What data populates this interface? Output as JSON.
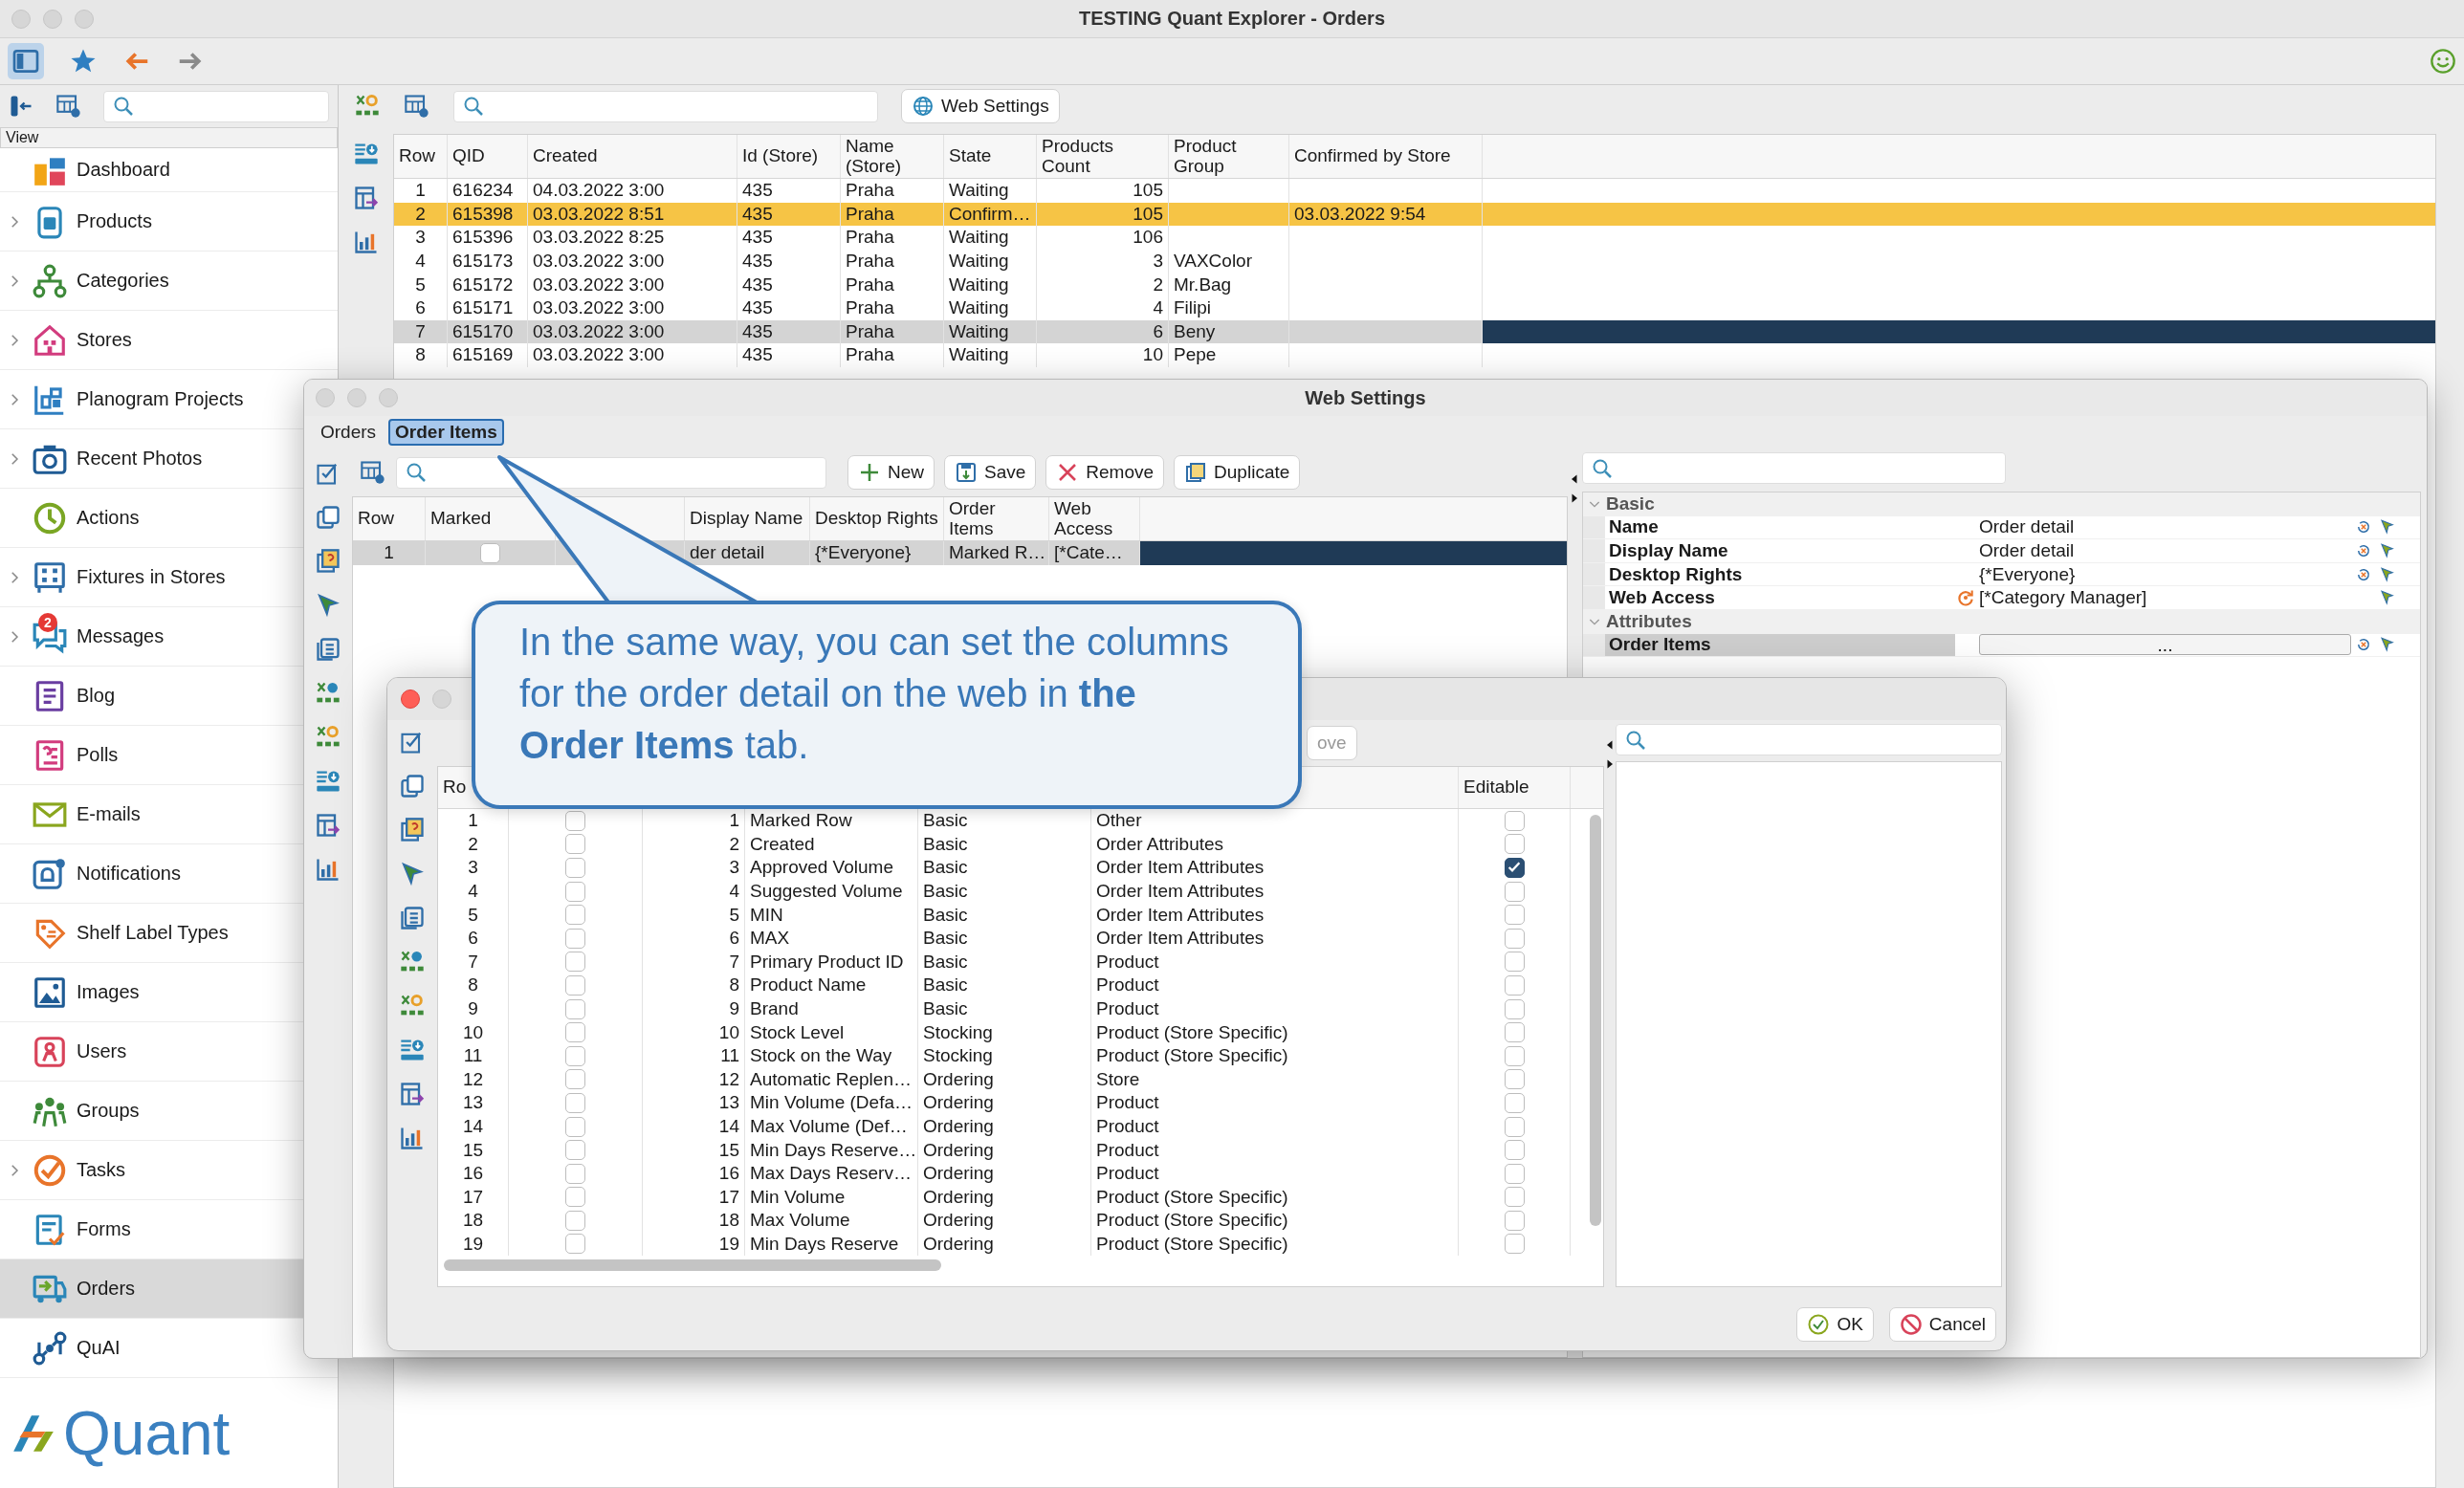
{
  "window": {
    "title": "TESTING Quant Explorer - Orders"
  },
  "sidebar": {
    "header": "View",
    "items": [
      {
        "label": "Dashboard",
        "expandable": false,
        "selected": false
      },
      {
        "label": "Products",
        "expandable": true,
        "selected": false
      },
      {
        "label": "Categories",
        "expandable": true,
        "selected": false
      },
      {
        "label": "Stores",
        "expandable": true,
        "selected": false
      },
      {
        "label": "Planogram Projects",
        "expandable": true,
        "selected": false
      },
      {
        "label": "Recent Photos",
        "expandable": true,
        "selected": false
      },
      {
        "label": "Actions",
        "expandable": false,
        "selected": false
      },
      {
        "label": "Fixtures in Stores",
        "expandable": true,
        "selected": false
      },
      {
        "label": "Messages",
        "expandable": true,
        "selected": false,
        "badge": "2"
      },
      {
        "label": "Blog",
        "expandable": false,
        "selected": false
      },
      {
        "label": "Polls",
        "expandable": false,
        "selected": false
      },
      {
        "label": "E-mails",
        "expandable": false,
        "selected": false
      },
      {
        "label": "Notifications",
        "expandable": false,
        "selected": false
      },
      {
        "label": "Shelf Label Types",
        "expandable": false,
        "selected": false
      },
      {
        "label": "Images",
        "expandable": false,
        "selected": false
      },
      {
        "label": "Users",
        "expandable": false,
        "selected": false
      },
      {
        "label": "Groups",
        "expandable": false,
        "selected": false
      },
      {
        "label": "Tasks",
        "expandable": true,
        "selected": false
      },
      {
        "label": "Forms",
        "expandable": false,
        "selected": false
      },
      {
        "label": "Orders",
        "expandable": false,
        "selected": true
      },
      {
        "label": "QuAI",
        "expandable": false,
        "selected": false
      }
    ],
    "logo": "Quant"
  },
  "orders": {
    "web_settings_button": "Web Settings",
    "columns": [
      "Row",
      "QID",
      "Created",
      "Id (Store)",
      "Name (Store)",
      "State",
      "Products Count",
      "Product Group",
      "Confirmed by Store"
    ],
    "rows": [
      {
        "row": "1",
        "qid": "616234",
        "created": "04.03.2022 3:00",
        "id_store": "435",
        "name_store": "Praha",
        "state": "Waiting",
        "products_count": "105",
        "selected": false
      },
      {
        "row": "2",
        "qid": "615398",
        "created": "03.03.2022 8:51",
        "id_store": "435",
        "name_store": "Praha",
        "state": "Confirm…",
        "products_count": "105",
        "confirmed_by_store": "03.03.2022 9:54",
        "selected": false,
        "color": "#f6c445"
      },
      {
        "row": "3",
        "qid": "615396",
        "created": "03.03.2022 8:25",
        "id_store": "435",
        "name_store": "Praha",
        "state": "Waiting",
        "products_count": "106",
        "selected": false
      },
      {
        "row": "4",
        "qid": "615173",
        "created": "03.03.2022 3:00",
        "id_store": "435",
        "name_store": "Praha",
        "state": "Waiting",
        "products_count": "3",
        "product_group": "VAXColor",
        "selected": false
      },
      {
        "row": "5",
        "qid": "615172",
        "created": "03.03.2022 3:00",
        "id_store": "435",
        "name_store": "Praha",
        "state": "Waiting",
        "products_count": "2",
        "product_group": "Mr.Bag",
        "selected": false
      },
      {
        "row": "6",
        "qid": "615171",
        "created": "03.03.2022 3:00",
        "id_store": "435",
        "name_store": "Praha",
        "state": "Waiting",
        "products_count": "4",
        "product_group": "Filipi",
        "selected": false
      },
      {
        "row": "7",
        "qid": "615170",
        "created": "03.03.2022 3:00",
        "id_store": "435",
        "name_store": "Praha",
        "state": "Waiting",
        "products_count": "6",
        "product_group": "Beny",
        "selected": true
      },
      {
        "row": "8",
        "qid": "615169",
        "created": "03.03.2022 3:00",
        "id_store": "435",
        "name_store": "Praha",
        "state": "Waiting",
        "products_count": "10",
        "product_group": "Pepe",
        "selected": false
      }
    ]
  },
  "web_settings": {
    "title": "Web Settings",
    "tabs": [
      {
        "label": "Orders",
        "selected": false
      },
      {
        "label": "Order Items",
        "selected": true
      }
    ],
    "buttons": [
      "New",
      "Save",
      "Remove",
      "Duplicate"
    ],
    "columns": {
      "row": "Row",
      "marked": "Marked",
      "display_name": "Display Name",
      "desktop_rights": "Desktop Rights",
      "order_items": "Order Items",
      "web_access": "Web Access"
    },
    "rows": [
      {
        "row": "1",
        "marked": false,
        "display_name": "der detail",
        "desktop_rights": "{*Everyone}",
        "order_items": "Marked R…",
        "web_access": "[*Cate…",
        "selected": true
      }
    ],
    "properties": {
      "sections": [
        {
          "label": "Basic",
          "expanded": true,
          "rows": [
            {
              "name": "Name",
              "value": "Order detail",
              "kind": "text",
              "resettable": true,
              "overridden": false,
              "selected": false
            },
            {
              "name": "Display Name",
              "value": "Order detail",
              "kind": "text",
              "resettable": true,
              "overridden": false,
              "selected": false
            },
            {
              "name": "Desktop Rights",
              "value": "{*Everyone}",
              "kind": "text",
              "resettable": true,
              "overridden": false,
              "selected": false
            },
            {
              "name": "Web Access",
              "value": "[*Category Manager]",
              "kind": "text",
              "resettable": false,
              "overridden": true,
              "selected": false
            }
          ]
        },
        {
          "label": "Attributes",
          "expanded": true,
          "rows": [
            {
              "name": "Order Items",
              "value": "...",
              "kind": "button",
              "resettable": true,
              "overridden": false,
              "selected": true
            }
          ]
        }
      ]
    }
  },
  "column_dialog": {
    "toolbar_button": "ove",
    "columns": {
      "row": "Ro",
      "editable": "Editable"
    },
    "rows": [
      {
        "row": "1",
        "marked": false,
        "column_3": "1",
        "column_4": "Marked Row",
        "column_5": "Basic",
        "column_6": "Other",
        "editable": false
      },
      {
        "row": "2",
        "marked": false,
        "column_3": "2",
        "column_4": "Created",
        "column_5": "Basic",
        "column_6": "Order Attributes",
        "editable": false
      },
      {
        "row": "3",
        "marked": false,
        "column_3": "3",
        "column_4": "Approved Volume",
        "column_5": "Basic",
        "column_6": "Order Item Attributes",
        "editable": true
      },
      {
        "row": "4",
        "marked": false,
        "column_3": "4",
        "column_4": "Suggested Volume",
        "column_5": "Basic",
        "column_6": "Order Item Attributes",
        "editable": false
      },
      {
        "row": "5",
        "marked": false,
        "column_3": "5",
        "column_4": "MIN",
        "column_5": "Basic",
        "column_6": "Order Item Attributes",
        "editable": false
      },
      {
        "row": "6",
        "marked": false,
        "column_3": "6",
        "column_4": "MAX",
        "column_5": "Basic",
        "column_6": "Order Item Attributes",
        "editable": false
      },
      {
        "row": "7",
        "marked": false,
        "column_3": "7",
        "column_4": "Primary Product ID",
        "column_5": "Basic",
        "column_6": "Product",
        "editable": false
      },
      {
        "row": "8",
        "marked": false,
        "column_3": "8",
        "column_4": "Product Name",
        "column_5": "Basic",
        "column_6": "Product",
        "editable": false
      },
      {
        "row": "9",
        "marked": false,
        "column_3": "9",
        "column_4": "Brand",
        "column_5": "Basic",
        "column_6": "Product",
        "editable": false
      },
      {
        "row": "10",
        "marked": false,
        "column_3": "10",
        "column_4": "Stock Level",
        "column_5": "Stocking",
        "column_6": "Product (Store Specific)",
        "editable": false
      },
      {
        "row": "11",
        "marked": false,
        "column_3": "11",
        "column_4": "Stock on the Way",
        "column_5": "Stocking",
        "column_6": "Product (Store Specific)",
        "editable": false
      },
      {
        "row": "12",
        "marked": false,
        "column_3": "12",
        "column_4": "Automatic Replen…",
        "column_5": "Ordering",
        "column_6": "Store",
        "editable": false
      },
      {
        "row": "13",
        "marked": false,
        "column_3": "13",
        "column_4": "Min Volume (Defa…",
        "column_5": "Ordering",
        "column_6": "Product",
        "editable": false
      },
      {
        "row": "14",
        "marked": false,
        "column_3": "14",
        "column_4": "Max Volume (Def…",
        "column_5": "Ordering",
        "column_6": "Product",
        "editable": false
      },
      {
        "row": "15",
        "marked": false,
        "column_3": "15",
        "column_4": "Min Days Reserve…",
        "column_5": "Ordering",
        "column_6": "Product",
        "editable": false
      },
      {
        "row": "16",
        "marked": false,
        "column_3": "16",
        "column_4": "Max Days Reserv…",
        "column_5": "Ordering",
        "column_6": "Product",
        "editable": false
      },
      {
        "row": "17",
        "marked": false,
        "column_3": "17",
        "column_4": "Min Volume",
        "column_5": "Ordering",
        "column_6": "Product (Store Specific)",
        "editable": false
      },
      {
        "row": "18",
        "marked": false,
        "column_3": "18",
        "column_4": "Max Volume",
        "column_5": "Ordering",
        "column_6": "Product (Store Specific)",
        "editable": false
      },
      {
        "row": "19",
        "marked": false,
        "column_3": "19",
        "column_4": "Min Days Reserve",
        "column_5": "Ordering",
        "column_6": "Product (Store Specific)",
        "editable": false
      }
    ],
    "buttons": [
      "OK",
      "Cancel"
    ]
  },
  "callout": {
    "text": "In the same way, you can set the columns for the order detail on the web in **the Order Items** tab."
  }
}
